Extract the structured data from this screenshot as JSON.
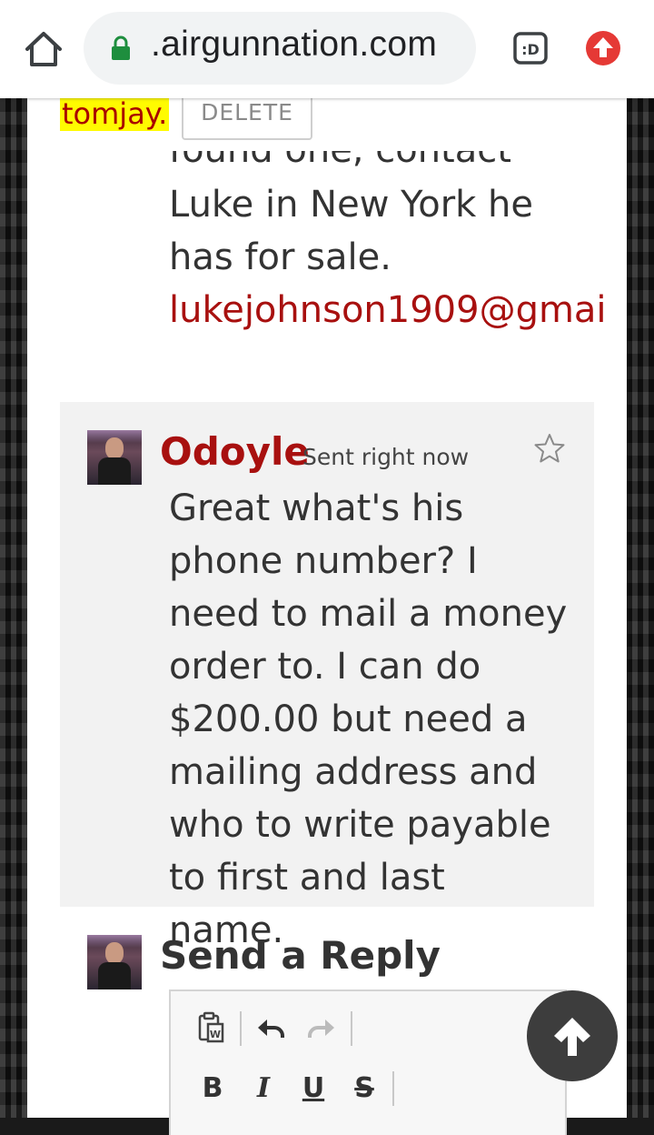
{
  "browser": {
    "url": ".airgunnation.com",
    "home_icon": "home-icon",
    "lock_icon": "lock-icon",
    "extension_icon": "extension-icon",
    "extension_label": ":D",
    "update_icon": "update-icon",
    "update_color": "#e53935",
    "lock_color": "#1e8e3e"
  },
  "previous": {
    "username": "tomjay.",
    "delete_label": "DELETE",
    "partial_line": "found one, contact",
    "line1": "Luke in New York he",
    "line2": "has for sale.",
    "email": "lukejohnson1909@gmai"
  },
  "comment": {
    "author": "Odoyle",
    "sent": "Sent right now",
    "star_icon": "star-icon",
    "text": "Great what's his phone number? I need to mail a money order to. I can do $200.00 but need a mailing address and who to write payable to first and last name."
  },
  "reply": {
    "title": "Send a Reply",
    "toolbar": {
      "paste_icon": "paste-word-icon",
      "undo_icon": "undo-icon",
      "redo_icon": "redo-icon",
      "bold": "B",
      "italic": "I",
      "underline": "U",
      "strike": "S"
    }
  },
  "scroll_top_icon": "arrow-up-icon",
  "colors": {
    "accent": "#a8100f",
    "highlight": "#fffb00"
  }
}
